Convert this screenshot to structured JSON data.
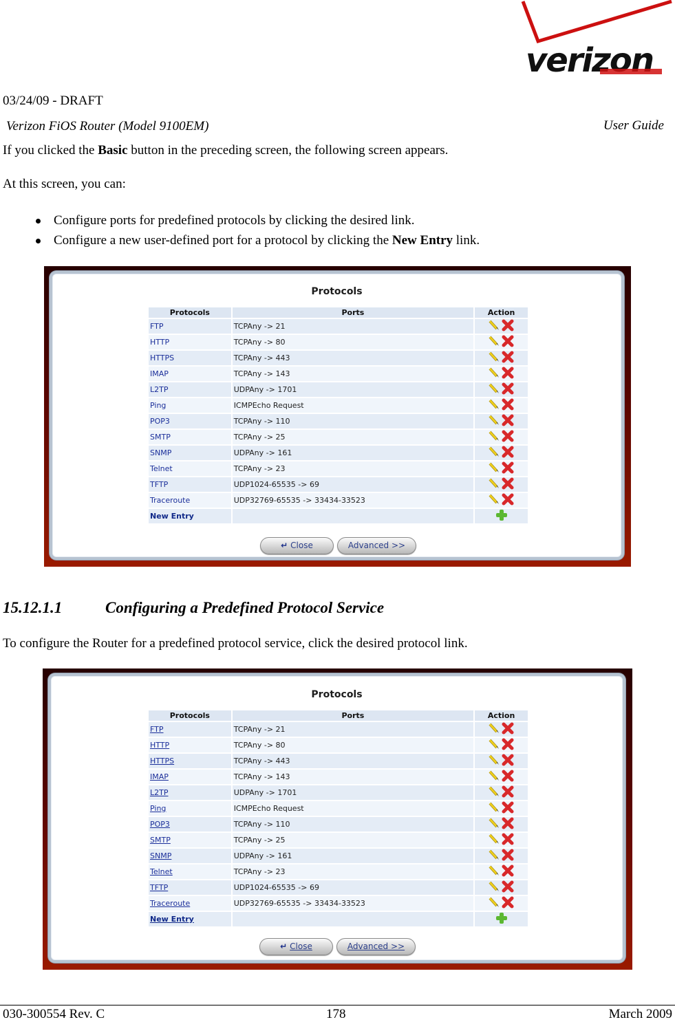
{
  "header": {
    "logo_text": "verizon",
    "date_draft": "03/24/09 - DRAFT",
    "model": "Verizon FiOS Router (Model 9100EM)",
    "guide": "User Guide"
  },
  "intro": {
    "p1_before": "If you clicked the ",
    "p1_bold": "Basic",
    "p1_after": " button in the preceding screen, the following screen appears.",
    "p2": "At this screen, you can:",
    "bullets": [
      {
        "before": "Configure ports for predefined protocols by clicking the desired link.",
        "bold": "",
        "after": ""
      },
      {
        "before": "Configure a new user-defined port for a protocol by clicking the ",
        "bold": "New Entry",
        "after": " link."
      }
    ]
  },
  "section": {
    "number": "15.12.1.1",
    "title": "Configuring a Predefined Protocol Service",
    "body": "To configure the Router for a predefined protocol service, click the desired protocol link."
  },
  "screen": {
    "title": "Protocols",
    "columns": [
      "Protocols",
      "Ports",
      "Action"
    ],
    "rows": [
      {
        "name": "FTP",
        "ports": "TCPAny -> 21"
      },
      {
        "name": "HTTP",
        "ports": "TCPAny -> 80"
      },
      {
        "name": "HTTPS",
        "ports": "TCPAny -> 443"
      },
      {
        "name": "IMAP",
        "ports": "TCPAny -> 143"
      },
      {
        "name": "L2TP",
        "ports": "UDPAny -> 1701"
      },
      {
        "name": "Ping",
        "ports": "ICMPEcho Request"
      },
      {
        "name": "POP3",
        "ports": "TCPAny -> 110"
      },
      {
        "name": "SMTP",
        "ports": "TCPAny -> 25"
      },
      {
        "name": "SNMP",
        "ports": "UDPAny -> 161"
      },
      {
        "name": "Telnet",
        "ports": "TCPAny -> 23"
      },
      {
        "name": "TFTP",
        "ports": "UDP1024-65535 -> 69"
      },
      {
        "name": "Traceroute",
        "ports": "UDP32769-65535 -> 33434-33523"
      }
    ],
    "new_entry": "New Entry",
    "close_label": "Close",
    "advanced_label": "Advanced >>"
  },
  "footer": {
    "doc_number": "030-300554 Rev. C",
    "page": "178",
    "date": "March 2009"
  },
  "colors": {
    "frame_dark": "#260000",
    "frame_red": "#9a1a00",
    "link_blue": "#1b2f9a",
    "row_odd": "#e4ecf6",
    "row_even": "#f0f5fb",
    "header_bg": "#dde6f2"
  }
}
